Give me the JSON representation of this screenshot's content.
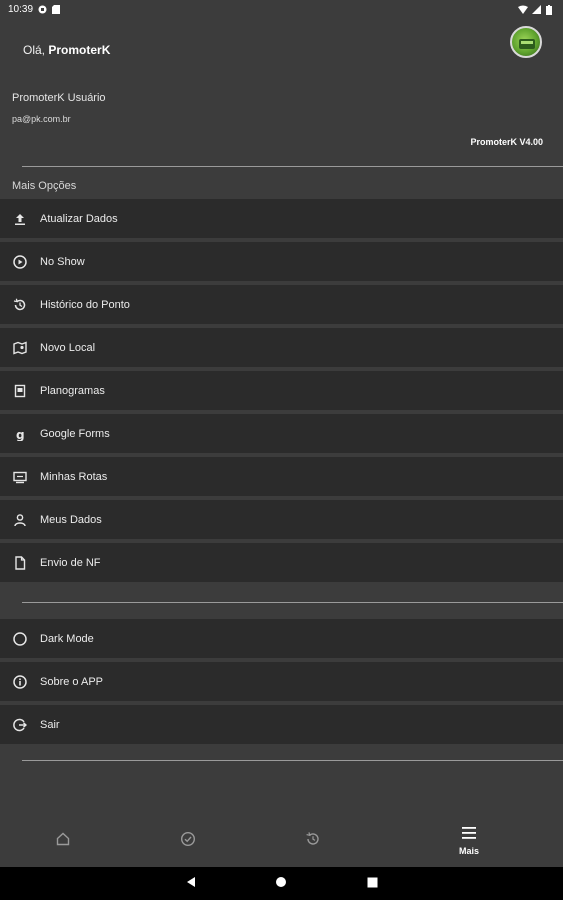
{
  "status_bar": {
    "time": "10:39"
  },
  "header": {
    "greeting_prefix": "Olá, ",
    "greeting_name": "PromoterK",
    "user_name": "PromoterK Usuário",
    "user_email": "pa@pk.com.br",
    "version": "PromoterK V4.00"
  },
  "section": {
    "label": "Mais Opções"
  },
  "menu": [
    {
      "label": "Atualizar Dados",
      "icon": "upload-icon"
    },
    {
      "label": "No Show",
      "icon": "play-circle-icon"
    },
    {
      "label": "Histórico do Ponto",
      "icon": "history-icon"
    },
    {
      "label": "Novo Local",
      "icon": "map-icon"
    },
    {
      "label": "Planogramas",
      "icon": "planogram-icon"
    },
    {
      "label": "Google Forms",
      "icon": "google-icon"
    },
    {
      "label": "Minhas Rotas",
      "icon": "routes-icon"
    },
    {
      "label": "Meus Dados",
      "icon": "person-icon"
    },
    {
      "label": "Envio de NF",
      "icon": "document-icon"
    }
  ],
  "menu2": [
    {
      "label": "Dark Mode",
      "icon": "circle-icon"
    },
    {
      "label": "Sobre o APP",
      "icon": "info-icon"
    },
    {
      "label": "Sair",
      "icon": "logout-icon"
    }
  ],
  "bottom_nav": {
    "active_label": "Mais"
  },
  "colors": {
    "background": "#3c3c3c",
    "item_bg": "#2b2b2b",
    "text": "#ececec"
  }
}
